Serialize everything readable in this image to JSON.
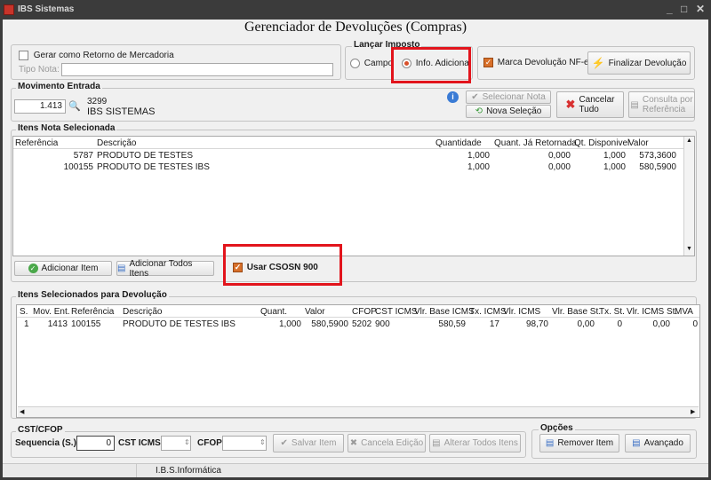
{
  "window": {
    "title": "IBS Sistemas",
    "minimize": "_",
    "maximize": "□",
    "close": "✕"
  },
  "headline": "Gerenciador de Devoluções (Compras)",
  "retorno": {
    "label": "Gerar como Retorno de Mercadoria",
    "tipo_nota_label": "Tipo Nota:",
    "tipo_nota_value": ""
  },
  "lancar_imposto": {
    "title": "Lançar Imposto",
    "options": [
      "Campo",
      "Info. Adicional"
    ],
    "selected": "Info. Adicional"
  },
  "marca_devolucao": {
    "label": "Marca Devolução NF-e",
    "checked": true
  },
  "finalizar_label": "Finalizar Devolução",
  "movimento": {
    "title": "Movimento Entrada",
    "number": "1.413",
    "code": "3299",
    "name": "IBS SISTEMAS"
  },
  "actions": {
    "selecionar_nota": "Selecionar Nota",
    "nova_selecao": "Nova Seleção",
    "cancelar_tudo": [
      "Cancelar",
      "Tudo"
    ],
    "consulta_referencia": [
      "Consulta por",
      "Referência"
    ]
  },
  "itens_nota": {
    "title": "Itens Nota Selecionada",
    "columns": [
      "Referência",
      "Descrição",
      "Quantidade",
      "Quant. Já Retornada",
      "Qt. Disponivel",
      "Valor"
    ],
    "rows": [
      [
        "5787",
        "PRODUTO DE TESTES",
        "1,000",
        "0,000",
        "1,000",
        "573,3600"
      ],
      [
        "100155",
        "PRODUTO DE TESTES IBS",
        "1,000",
        "0,000",
        "1,000",
        "580,5900"
      ]
    ]
  },
  "adicionar_item": "Adicionar Item",
  "adicionar_todos": "Adicionar Todos Itens",
  "usar_csosn": {
    "label": "Usar CSOSN 900",
    "checked": true
  },
  "itens_selecionados": {
    "title": "Itens Selecionados para Devolução",
    "columns": [
      "S.",
      "Mov. Ent.",
      "Referência",
      "Descrição",
      "Quant.",
      "Valor",
      "CFOP",
      "CST ICMS",
      "Vlr. Base ICMS",
      "Tx. ICMS",
      "Vlr. ICMS",
      "Vlr. Base St.",
      "Tx. St.",
      "Vlr. ICMS St.",
      "MVA"
    ],
    "rows": [
      [
        "1",
        "1413",
        "100155",
        "PRODUTO DE TESTES IBS",
        "1,000",
        "580,5900",
        "5202",
        "900",
        "580,59",
        "17",
        "98,70",
        "0,00",
        "0",
        "0,00",
        "0"
      ]
    ]
  },
  "cst_cfop": {
    "title": "CST/CFOP",
    "sequencia_label": "Sequencia (S.)",
    "sequencia_value": "0",
    "cst_label": "CST ICMS",
    "cfop_label": "CFOP"
  },
  "bottom_buttons": {
    "salvar": "Salvar Item",
    "cancelar_edicao": "Cancela Edição",
    "alterar_todos": "Alterar Todos Itens"
  },
  "opcoes": {
    "title": "Opções",
    "remover": "Remover Item",
    "avancado": "Avançado"
  },
  "statusbar": "I.B.S.Informática",
  "colors": {
    "accent": "#d8702a",
    "highlight": "#e2141c",
    "titlebar": "#3b3b3b"
  }
}
